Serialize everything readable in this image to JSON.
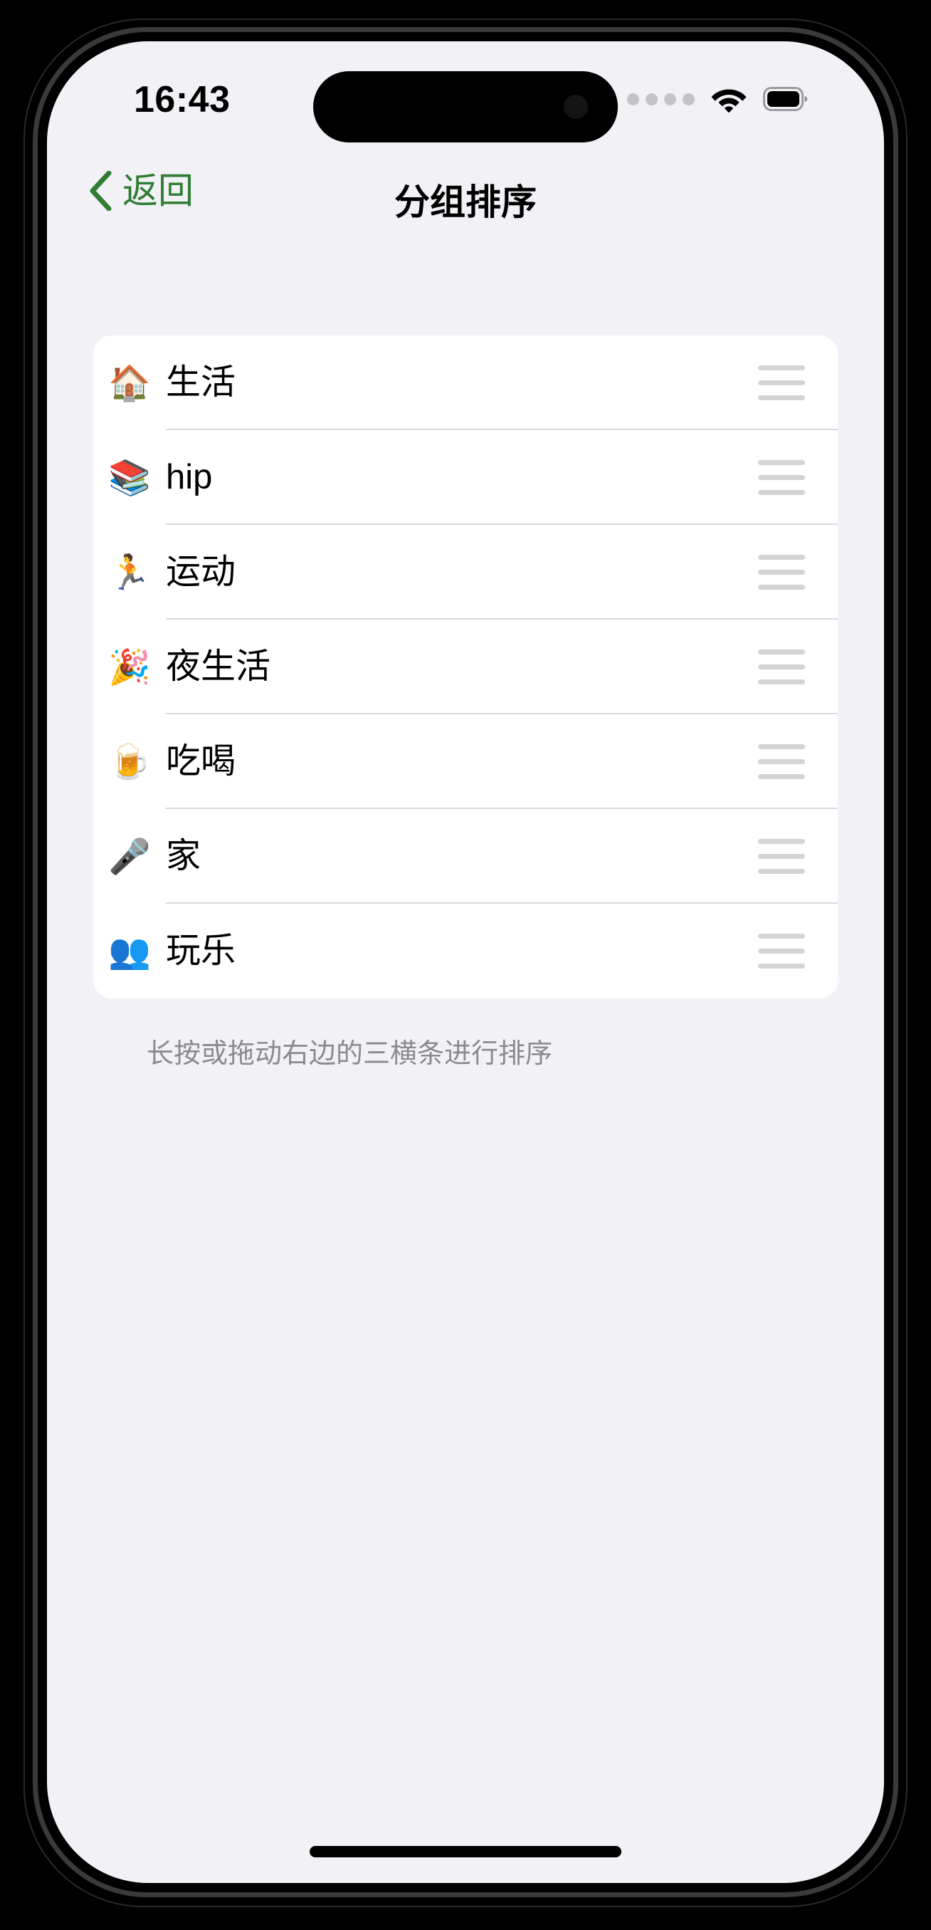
{
  "status_bar": {
    "time": "16:43",
    "signal_icon": "cellular-dots-icon",
    "wifi_icon": "wifi-icon",
    "battery_icon": "battery-full-icon"
  },
  "nav_bar": {
    "back_label": "返回",
    "back_icon": "chevron-left-icon",
    "title": "分组排序"
  },
  "list": {
    "rows": [
      {
        "emoji": "🏠",
        "icon_name": "house-icon",
        "label": "生活",
        "handle_icon": "drag-handle-icon"
      },
      {
        "emoji": "📚",
        "icon_name": "books-icon",
        "label": "hip",
        "handle_icon": "drag-handle-icon"
      },
      {
        "emoji": "🏃",
        "icon_name": "runner-icon",
        "label": "运动",
        "handle_icon": "drag-handle-icon"
      },
      {
        "emoji": "🎉",
        "icon_name": "party-popper-icon",
        "label": "夜生活",
        "handle_icon": "drag-handle-icon"
      },
      {
        "emoji": "🍺",
        "icon_name": "beer-mug-icon",
        "label": "吃喝",
        "handle_icon": "drag-handle-icon"
      },
      {
        "emoji": "🎤",
        "icon_name": "microphone-icon",
        "label": "家",
        "handle_icon": "drag-handle-icon"
      },
      {
        "emoji": "👥",
        "icon_name": "people-group-icon",
        "label": "玩乐",
        "handle_icon": "drag-handle-icon"
      }
    ]
  },
  "footer": {
    "hint": "长按或拖动右边的三横条进行排序"
  },
  "colors": {
    "accent_green": "#2e7d32",
    "screen_background": "#f2f1f6",
    "card_background": "#ffffff",
    "separator": "#d9d9dd",
    "handle_gray": "#d4d4d6",
    "hint_gray": "#8a8a90"
  }
}
